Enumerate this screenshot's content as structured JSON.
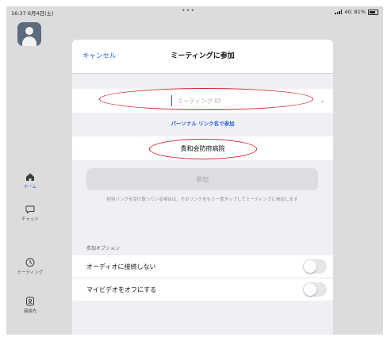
{
  "status_bar": {
    "time": "16:37",
    "date": "6月4日(土)",
    "dots": "•••",
    "network": "4G",
    "battery": "81%"
  },
  "sidebar": {
    "items": [
      {
        "label": "ホーム",
        "icon": "home-icon",
        "active": true
      },
      {
        "label": "チャット",
        "icon": "chat-icon"
      },
      {
        "label": "ミーティング",
        "icon": "clock-icon"
      },
      {
        "label": "連絡先",
        "icon": "contacts-icon"
      }
    ]
  },
  "modal": {
    "cancel_label": "キャンセル",
    "title": "ミーティングに参加",
    "meeting_id_placeholder": "ミーティング ID",
    "personal_link_label": "パーソナル リンク名で参加",
    "display_name_value": "貴和会防府病院",
    "join_label": "参加",
    "note": "招待リンクを受け取っている場合は、そのリンクをもう一度タップしてミーティングに参加します",
    "options_header": "参加オプション",
    "options": [
      {
        "label": "オーディオに接続しない",
        "on": false
      },
      {
        "label": "マイビデオをオフにする",
        "on": false
      }
    ]
  },
  "colors": {
    "accent": "#2d63d6",
    "annotation": "#d4202a"
  }
}
